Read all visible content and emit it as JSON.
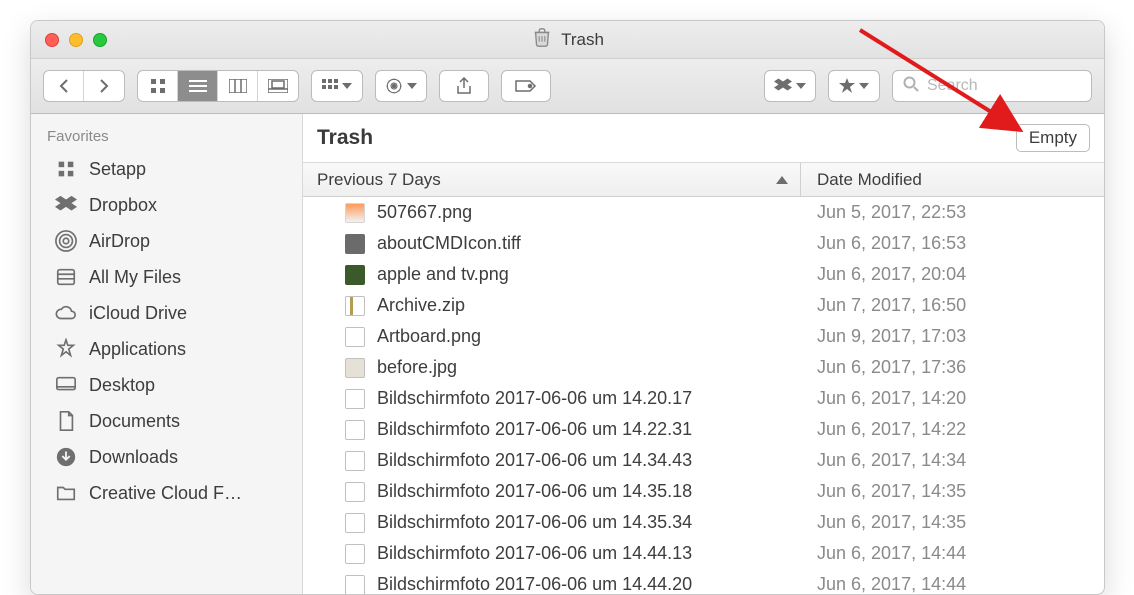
{
  "window": {
    "title": "Trash"
  },
  "search": {
    "placeholder": "Search",
    "value": ""
  },
  "sidebar": {
    "section": "Favorites",
    "items": [
      {
        "label": "Setapp",
        "icon": "setapp-icon"
      },
      {
        "label": "Dropbox",
        "icon": "dropbox-icon"
      },
      {
        "label": "AirDrop",
        "icon": "airdrop-icon"
      },
      {
        "label": "All My Files",
        "icon": "all-my-files-icon"
      },
      {
        "label": "iCloud Drive",
        "icon": "icloud-icon"
      },
      {
        "label": "Applications",
        "icon": "applications-icon"
      },
      {
        "label": "Desktop",
        "icon": "desktop-icon"
      },
      {
        "label": "Documents",
        "icon": "documents-icon"
      },
      {
        "label": "Downloads",
        "icon": "downloads-icon"
      },
      {
        "label": "Creative Cloud F…",
        "icon": "folder-icon"
      }
    ]
  },
  "main": {
    "title": "Trash",
    "empty_button": "Empty",
    "columns": {
      "group": "Previous 7 Days",
      "date": "Date Modified"
    },
    "files": [
      {
        "name": "507667.png",
        "date": "Jun 5, 2017, 22:53",
        "icon": "fic-img"
      },
      {
        "name": "aboutCMDIcon.tiff",
        "date": "Jun 6, 2017, 16:53",
        "icon": "fic-tiff"
      },
      {
        "name": "apple and tv.png",
        "date": "Jun 6, 2017, 20:04",
        "icon": "fic-photo"
      },
      {
        "name": "Archive.zip",
        "date": "Jun 7, 2017, 16:50",
        "icon": "fic-zip"
      },
      {
        "name": "Artboard.png",
        "date": "Jun 9, 2017, 17:03",
        "icon": "fic-doc"
      },
      {
        "name": "before.jpg",
        "date": "Jun 6, 2017, 17:36",
        "icon": "fic-jpg"
      },
      {
        "name": "Bildschirmfoto 2017-06-06 um 14.20.17",
        "date": "Jun 6, 2017, 14:20",
        "icon": "fic-png"
      },
      {
        "name": "Bildschirmfoto 2017-06-06 um 14.22.31",
        "date": "Jun 6, 2017, 14:22",
        "icon": "fic-png"
      },
      {
        "name": "Bildschirmfoto 2017-06-06 um 14.34.43",
        "date": "Jun 6, 2017, 14:34",
        "icon": "fic-png"
      },
      {
        "name": "Bildschirmfoto 2017-06-06 um 14.35.18",
        "date": "Jun 6, 2017, 14:35",
        "icon": "fic-png"
      },
      {
        "name": "Bildschirmfoto 2017-06-06 um 14.35.34",
        "date": "Jun 6, 2017, 14:35",
        "icon": "fic-png"
      },
      {
        "name": "Bildschirmfoto 2017-06-06 um 14.44.13",
        "date": "Jun 6, 2017, 14:44",
        "icon": "fic-png"
      },
      {
        "name": "Bildschirmfoto 2017-06-06 um 14.44.20",
        "date": "Jun 6, 2017, 14:44",
        "icon": "fic-png"
      }
    ]
  }
}
